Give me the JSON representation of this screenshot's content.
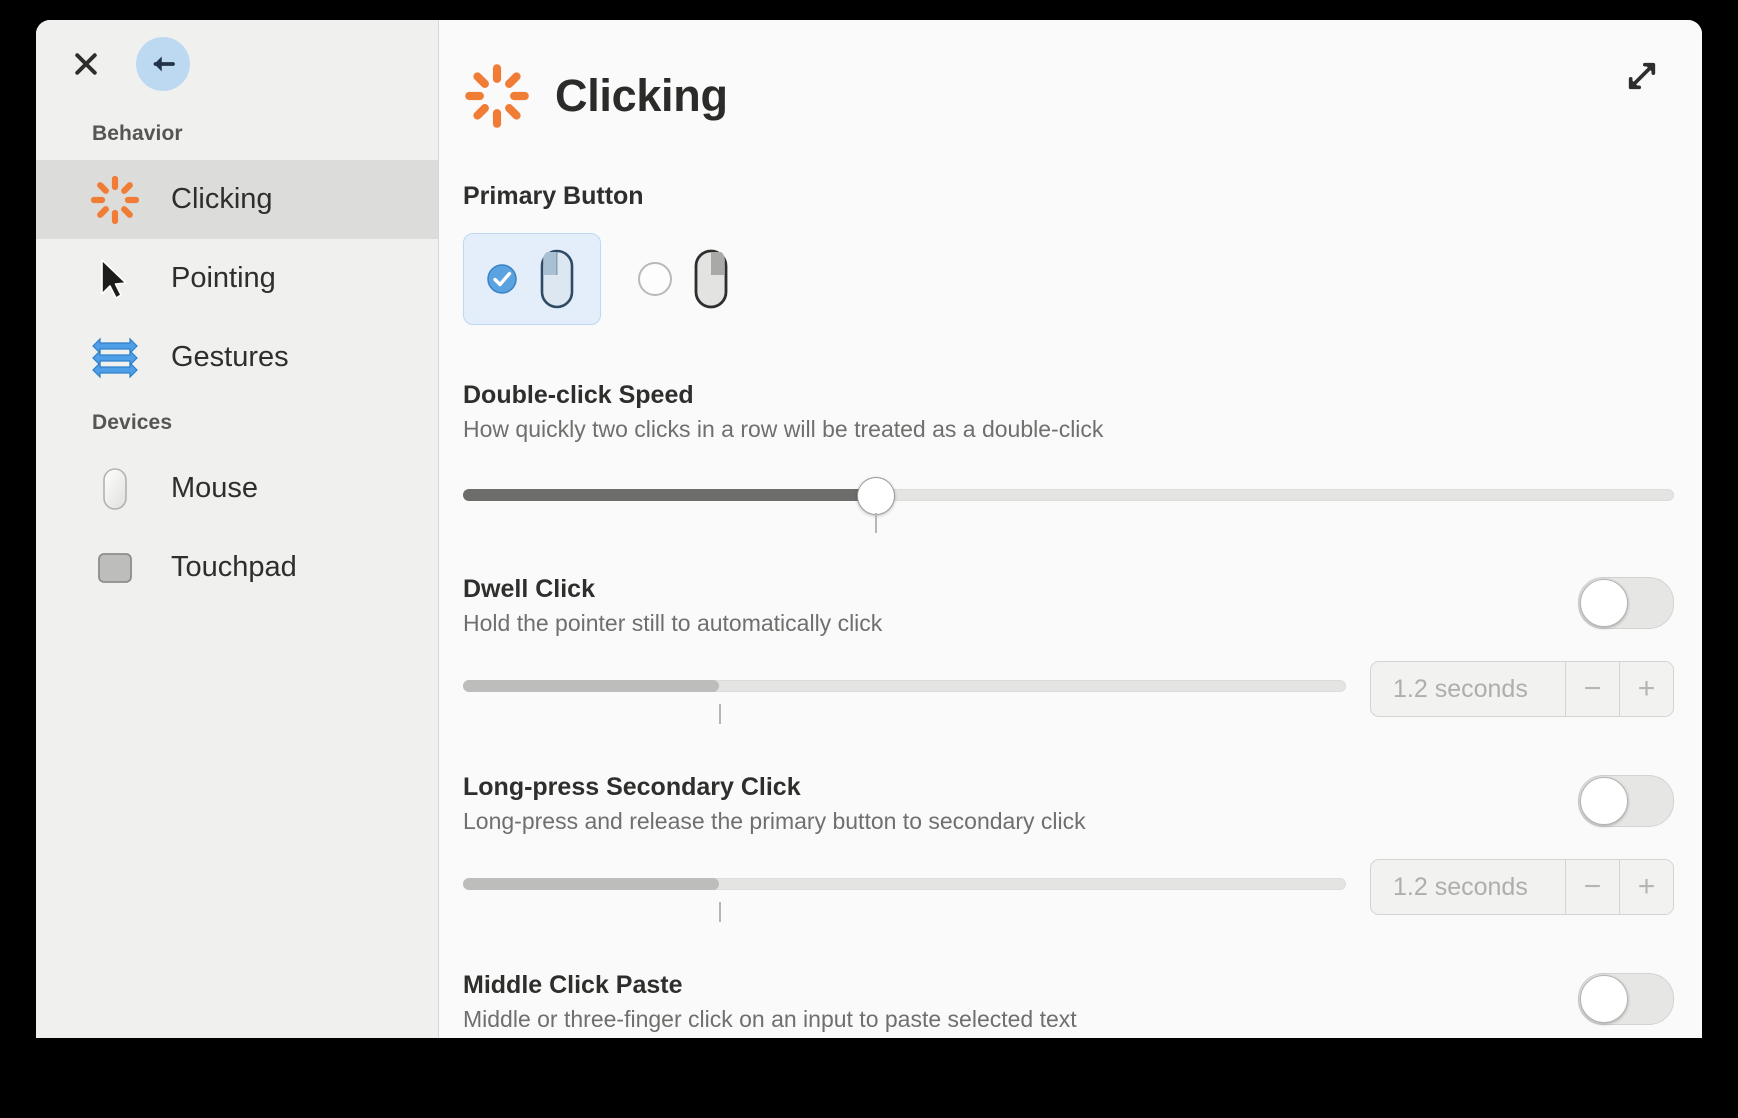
{
  "window": {
    "header_icons": {
      "close": "close-icon",
      "back": "back-arrow-icon",
      "expand": "expand-icon"
    }
  },
  "sidebar": {
    "groups": [
      {
        "label": "Behavior",
        "items": [
          {
            "label": "Clicking",
            "icon": "clicking-burst-icon",
            "selected": true
          },
          {
            "label": "Pointing",
            "icon": "cursor-arrow-icon",
            "selected": false
          },
          {
            "label": "Gestures",
            "icon": "gestures-arrows-icon",
            "selected": false
          }
        ]
      },
      {
        "label": "Devices",
        "items": [
          {
            "label": "Mouse",
            "icon": "mouse-icon",
            "selected": false
          },
          {
            "label": "Touchpad",
            "icon": "touchpad-icon",
            "selected": false
          }
        ]
      }
    ]
  },
  "page": {
    "title": "Clicking",
    "icon": "clicking-burst-icon"
  },
  "primary_button": {
    "title": "Primary Button",
    "options": [
      {
        "name": "left-button",
        "selected": true,
        "icon": "mouse-left-highlight-icon"
      },
      {
        "name": "right-button",
        "selected": false,
        "icon": "mouse-right-highlight-icon"
      }
    ]
  },
  "double_click_speed": {
    "title": "Double-click Speed",
    "description": "How quickly two clicks in a row will be treated as a double-click",
    "slider_percent": 34
  },
  "dwell_click": {
    "title": "Dwell Click",
    "description": "Hold the pointer still to automatically click",
    "enabled": false,
    "slider_percent": 29,
    "stepper_value": "1.2 seconds",
    "minus_label": "−",
    "plus_label": "+"
  },
  "long_press_secondary_click": {
    "title": "Long-press Secondary Click",
    "description": "Long-press and release the primary button to secondary click",
    "enabled": false,
    "slider_percent": 29,
    "stepper_value": "1.2 seconds",
    "minus_label": "−",
    "plus_label": "+"
  },
  "middle_click_paste": {
    "title": "Middle Click Paste",
    "description": "Middle or three-finger click on an input to paste selected text",
    "enabled": false
  },
  "colors": {
    "accent_orange": "#f07c35",
    "accent_blue": "#bdd9f2",
    "selected_row": "#dcdcda",
    "option_selected_bg": "#e3eefa"
  }
}
